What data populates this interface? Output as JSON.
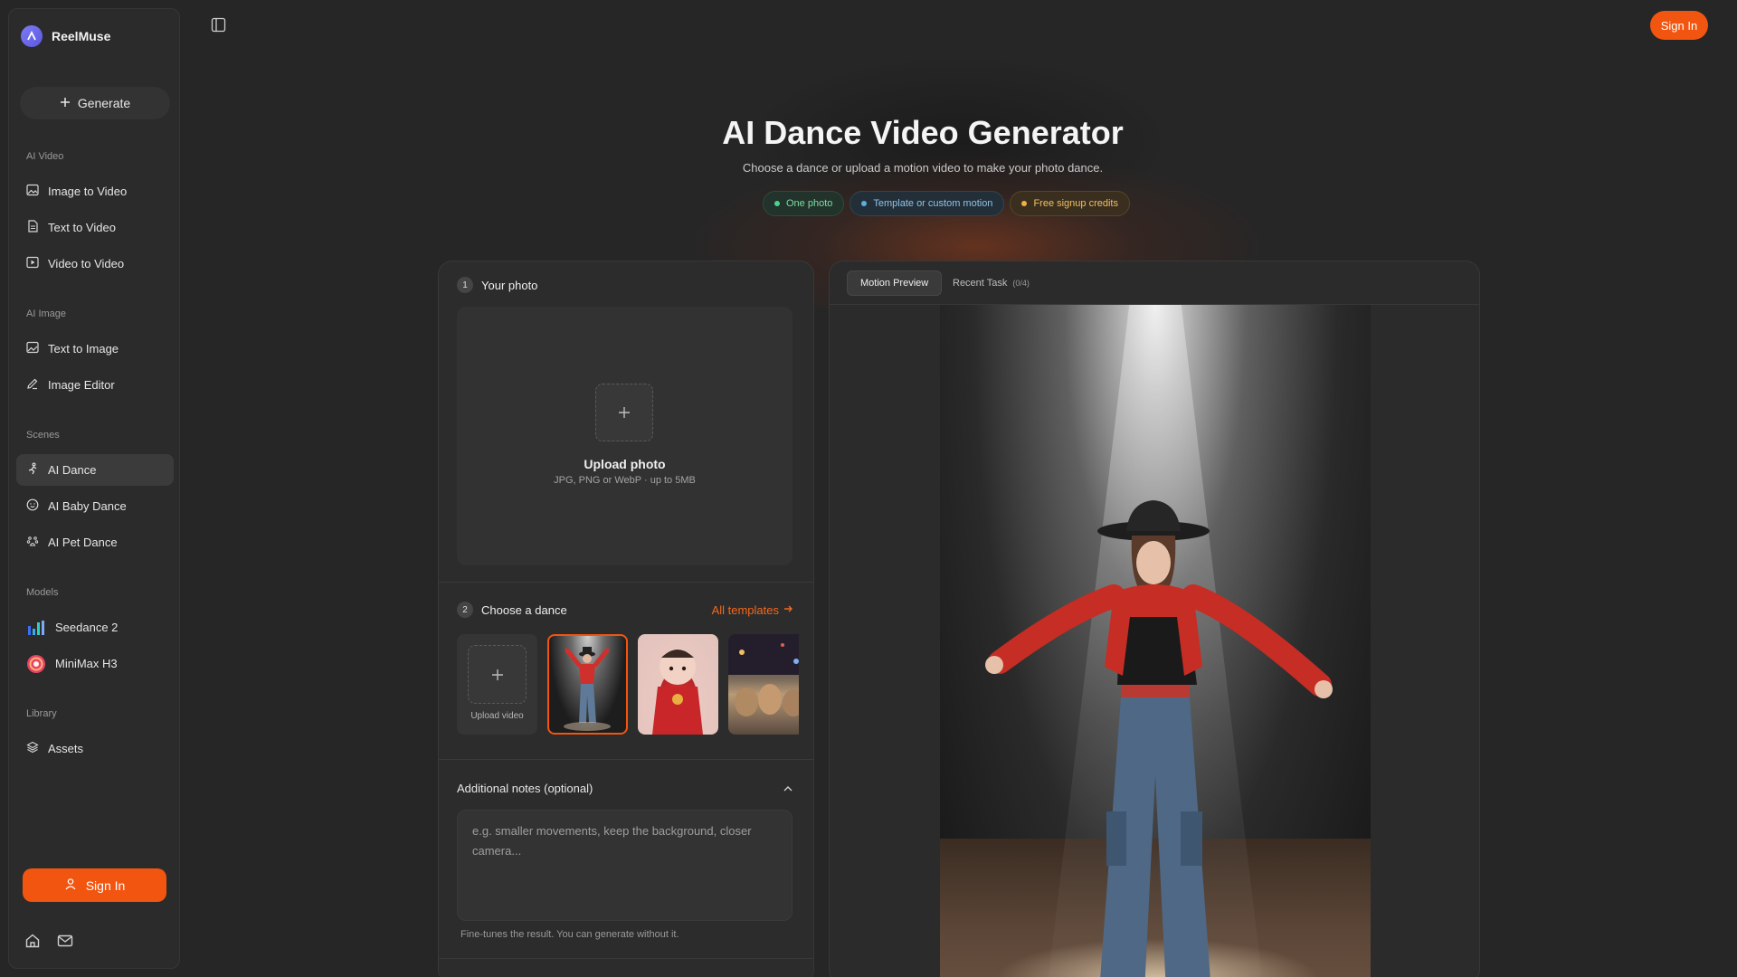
{
  "app": {
    "name": "ReelMuse"
  },
  "sidebar": {
    "generate_label": "Generate",
    "sections": {
      "ai_video": "AI Video",
      "ai_image": "AI Image",
      "scenes": "Scenes",
      "models": "Models",
      "library": "Library"
    },
    "items": {
      "image_to_video": "Image to Video",
      "text_to_video": "Text to Video",
      "video_to_video": "Video to Video",
      "text_to_image": "Text to Image",
      "image_editor": "Image Editor",
      "ai_dance": "AI Dance",
      "ai_baby_dance": "AI Baby Dance",
      "ai_pet_dance": "AI Pet Dance",
      "seedance": "Seedance 2",
      "minimax": "MiniMax H3",
      "assets": "Assets"
    },
    "active_item": "AI Dance",
    "signin_label": "Sign In"
  },
  "header": {
    "signin_label": "Sign In"
  },
  "hero": {
    "title": "AI Dance Video Generator",
    "subtitle": "Choose a dance or upload a motion video to make your photo dance.",
    "pills": [
      {
        "label": "One photo",
        "color": "#4fd18b"
      },
      {
        "label": "Template or custom motion",
        "color": "#5aaee0"
      },
      {
        "label": "Free signup credits",
        "color": "#f0b040"
      }
    ]
  },
  "form": {
    "step1": {
      "num": "1",
      "title": "Your photo"
    },
    "upload": {
      "title": "Upload photo",
      "hint": "JPG, PNG or WebP · up to 5MB"
    },
    "step2": {
      "num": "2",
      "title": "Choose a dance",
      "all_templates": "All templates"
    },
    "upload_video_label": "Upload video",
    "notes": {
      "title": "Additional notes (optional)",
      "placeholder": "e.g. smaller movements, keep the background, closer camera...",
      "help": "Fine-tunes the result. You can generate without it."
    }
  },
  "preview": {
    "tabs": [
      {
        "label": "Motion Preview",
        "active": true
      },
      {
        "label": "Recent Task",
        "count": "(0/4)"
      }
    ]
  },
  "colors": {
    "accent": "#f2550f",
    "link": "#f2691c"
  }
}
